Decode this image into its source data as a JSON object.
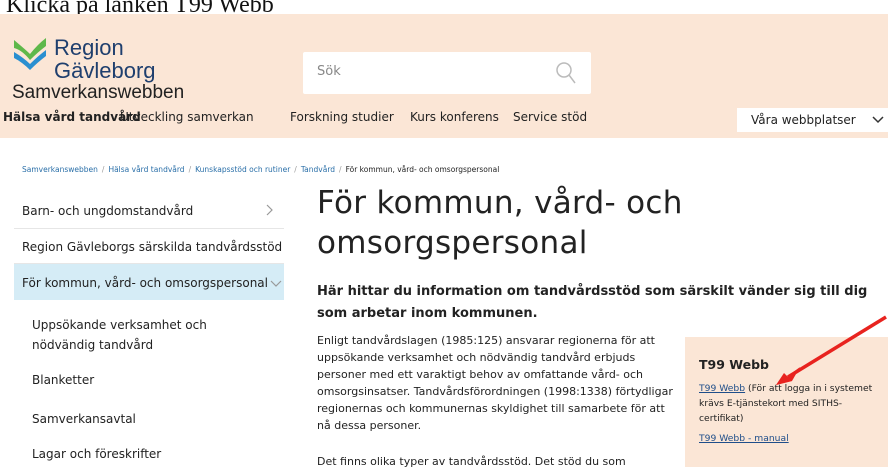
{
  "caption": "Klicka på länken T99 Webb",
  "header": {
    "logo_line1": "Region",
    "logo_line2": "Gävleborg",
    "site_name": "Samverkanswebben",
    "search_placeholder": "Sök",
    "nav": [
      "Hälsa vård tandvård",
      "Utveckling samverkan",
      "Forskning studier",
      "Kurs konferens",
      "Service stöd"
    ],
    "websites_button": "Våra webbplatser"
  },
  "breadcrumb": [
    "Samverkanswebben",
    "Hälsa vård tandvård",
    "Kunskapsstöd och rutiner",
    "Tandvård",
    "För kommun, vård- och omsorgspersonal"
  ],
  "sidebar": {
    "items": [
      "Barn- och ungdomstandvård",
      "Region Gävleborgs särskilda tandvårdsstöd",
      "För kommun, vård- och omsorgspersonal"
    ],
    "subitems": [
      "Uppsökande verksamhet och nödvändig tandvård",
      "Blanketter",
      "Samverkansavtal",
      "Lagar och föreskrifter"
    ]
  },
  "main": {
    "title": "För kommun, vård- och omsorgspersonal",
    "lead": "Här hittar du information om tandvårdsstöd som särskilt vänder sig till dig som arbetar inom kommunen.",
    "body": "Enligt tandvårdslagen (1985:125) ansvarar regionerna för att uppsökande verksamhet och nödvändig tandvård erbjuds personer med ett varaktigt behov av omfattande vård- och omsorgsinsatser. Tandvårdsförordningen (1998:1338) förtydligar regionernas och kommunernas skyldighet till samarbete för att nå dessa personer.",
    "body2": "Det finns olika typer av tandvårdsstöd. Det stöd du som"
  },
  "aside": {
    "title": "T99 Webb",
    "link1": "T99 Webb",
    "link1_note": " (För att logga in i systemet krävs E-tjänstekort med SITHS-certifikat)",
    "link2": "T99 Webb - manual"
  },
  "colors": {
    "header_bg": "#fbe6d6",
    "active_side": "#d5ecf6",
    "link": "#1f4e8a",
    "arrow": "#e8231f",
    "logo_green": "#5fb84a",
    "logo_blue": "#2a8fd0"
  }
}
